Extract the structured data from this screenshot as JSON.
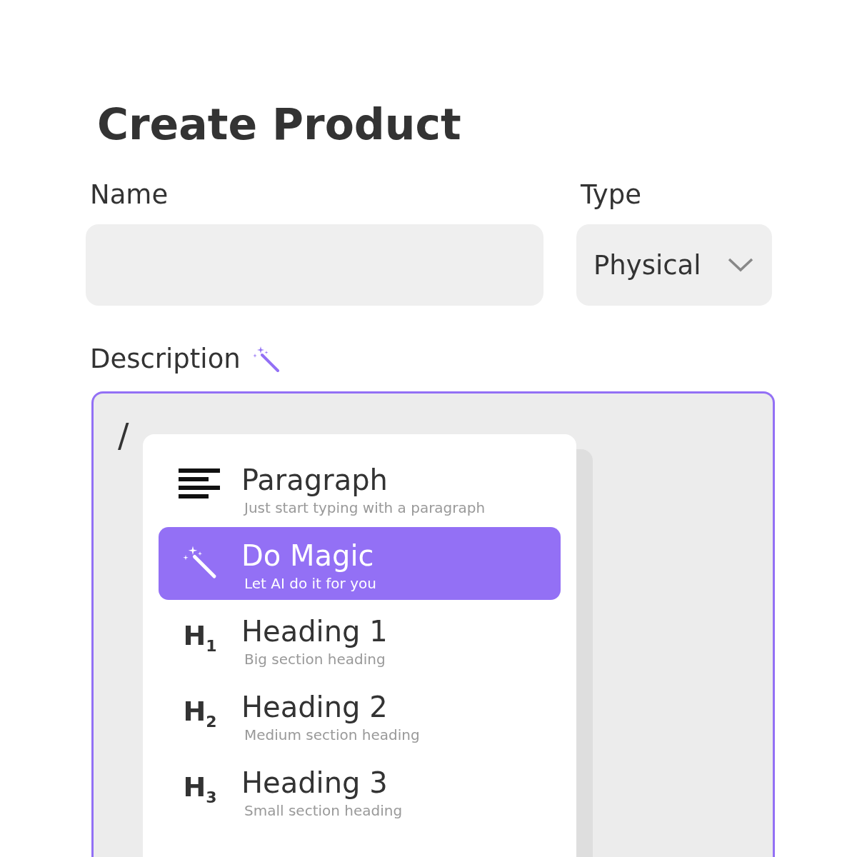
{
  "title": "Create Product",
  "name_field": {
    "label": "Name"
  },
  "type_field": {
    "label": "Type",
    "value": "Physical"
  },
  "description": {
    "label": "Description",
    "value": "/"
  },
  "menu": {
    "items": [
      {
        "kind": "paragraph",
        "title": "Paragraph",
        "subtitle": "Just start typing with a paragraph",
        "selected": false
      },
      {
        "kind": "magic",
        "title": "Do Magic",
        "subtitle": "Let AI do it for you",
        "selected": true
      },
      {
        "kind": "heading",
        "icon": "H$_{1}$",
        "title": "Heading 1",
        "subtitle": "Big section heading",
        "selected": false
      },
      {
        "kind": "heading",
        "icon": "H$_{2}$",
        "title": "Heading 2",
        "subtitle": "Medium section heading",
        "selected": false
      },
      {
        "kind": "heading",
        "icon": "H$_{3}$",
        "title": "Heading 3",
        "subtitle": "Small section heading",
        "selected": false
      }
    ]
  }
}
